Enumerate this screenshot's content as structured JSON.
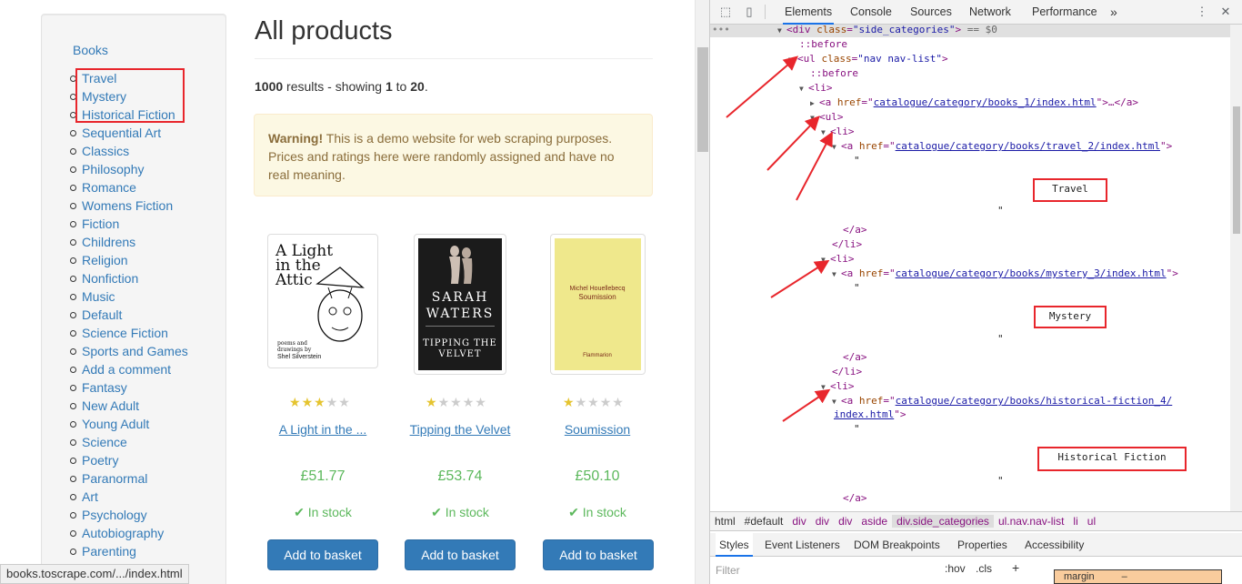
{
  "sidebar": {
    "root": "Books",
    "categories": [
      "Travel",
      "Mystery",
      "Historical Fiction",
      "Sequential Art",
      "Classics",
      "Philosophy",
      "Romance",
      "Womens Fiction",
      "Fiction",
      "Childrens",
      "Religion",
      "Nonfiction",
      "Music",
      "Default",
      "Science Fiction",
      "Sports and Games",
      "Add a comment",
      "Fantasy",
      "New Adult",
      "Young Adult",
      "Science",
      "Poetry",
      "Paranormal",
      "Art",
      "Psychology",
      "Autobiography",
      "Parenting"
    ]
  },
  "main": {
    "title": "All products",
    "results_count": "1000",
    "results_mid": " results - showing ",
    "results_from": "1",
    "results_to_word": " to ",
    "results_to": "20",
    "warning_strong": "Warning!",
    "warning_text": " This is a demo website for web scraping purposes. Prices and ratings here were randomly assigned and have no real meaning."
  },
  "products": [
    {
      "name": "A Light in the ...",
      "price": "£51.77",
      "stock": "In stock",
      "button": "Add to basket",
      "rating": 3,
      "cover_title": "A Light in the Attic",
      "cover_sub": "poems and drawings by",
      "cover_author": "Shel Silverstein"
    },
    {
      "name": "Tipping the Velvet",
      "price": "£53.74",
      "stock": "In stock",
      "button": "Add to basket",
      "rating": 1,
      "cover_author": "SARAH WATERS",
      "cover_title": "TIPPING THE VELVET"
    },
    {
      "name": "Soumission",
      "price": "£50.10",
      "stock": "In stock",
      "button": "Add to basket",
      "rating": 1,
      "cover_author": "Michel Houellebecq",
      "cover_title": "Soumission",
      "cover_publisher": "Flammarion"
    }
  ],
  "status_url": "books.toscrape.com/.../index.html",
  "devtools": {
    "tabs": [
      "Elements",
      "Console",
      "Sources",
      "Network",
      "Performance"
    ],
    "more": "»",
    "tree": {
      "sel_tag_open": "<div ",
      "sel_attr": "class",
      "sel_val": "\"side_categories\"",
      "sel_close": ">",
      "sel_eq": " == $0",
      "before": "::before",
      "ul_attr": "class",
      "ul_val": "\"nav nav-list\"",
      "href1": "catalogue/category/books_1/index.html",
      "href_travel": "catalogue/category/books/travel_2/index.html",
      "href_mystery": "catalogue/category/books/mystery_3/index.html",
      "href_hist_a": "catalogue/category/books/historical-fiction_4/",
      "href_hist_b": "index.html",
      "box_travel": "Travel",
      "box_mystery": "Mystery",
      "box_hist": "Historical Fiction"
    },
    "breadcrumb": [
      "html",
      "#default",
      "div",
      "div",
      "div",
      "aside",
      "div.side_categories",
      "ul.nav.nav-list",
      "li",
      "ul"
    ],
    "style_tabs": [
      "Styles",
      "Event Listeners",
      "DOM Breakpoints",
      "Properties",
      "Accessibility"
    ],
    "filter_placeholder": "Filter",
    "hov": ":hov",
    "cls": ".cls",
    "plus": "+",
    "margin_label": "margin",
    "margin_value": "–"
  },
  "colors": {
    "link": "#337ab7",
    "accent_red": "#e8262c",
    "price_green": "#5cb85c",
    "button_blue": "#337ab7",
    "star": "#e5c42f"
  }
}
